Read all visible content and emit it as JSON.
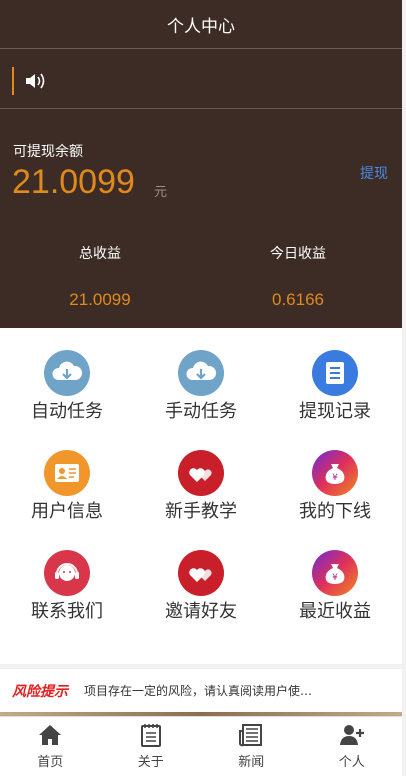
{
  "header": {
    "title": "个人中心"
  },
  "balance": {
    "label": "可提现余额",
    "amount": "21.0099",
    "unit": "元",
    "withdraw_label": "提现"
  },
  "stats": [
    {
      "label": "总收益",
      "value": "21.0099"
    },
    {
      "label": "今日收益",
      "value": "0.6166"
    }
  ],
  "menu": [
    {
      "label": "自动任务",
      "icon": "cloud-download-icon",
      "color": "#6fa4c8"
    },
    {
      "label": "手动任务",
      "icon": "cloud-download-icon",
      "color": "#6fa4c8"
    },
    {
      "label": "提现记录",
      "icon": "list-document-icon",
      "color": "#3a7be0"
    },
    {
      "label": "用户信息",
      "icon": "user-card-icon",
      "color": "#f0962a"
    },
    {
      "label": "新手教学",
      "icon": "hearts-icon",
      "color": "#c81f2a"
    },
    {
      "label": "我的下线",
      "icon": "money-bag-icon",
      "color": "#b0248a"
    },
    {
      "label": "联系我们",
      "icon": "headset-support-icon",
      "color": "#d8374b"
    },
    {
      "label": "邀请好友",
      "icon": "hearts-icon",
      "color": "#c81f2a"
    },
    {
      "label": "最近收益",
      "icon": "money-bag-icon",
      "color": "#b0248a"
    }
  ],
  "risk": {
    "tag": "风险提示",
    "text": "项目存在一定的风险，请认真阅读用户使…"
  },
  "tabs": [
    {
      "label": "首页",
      "icon": "home-icon"
    },
    {
      "label": "关于",
      "icon": "notepad-icon"
    },
    {
      "label": "新闻",
      "icon": "newspaper-icon"
    },
    {
      "label": "个人",
      "icon": "add-user-icon"
    }
  ],
  "colors": {
    "panel": "#3d2c25",
    "accent": "#e08a1e",
    "link": "#4a8ae8",
    "risk": "#e21f1f"
  }
}
